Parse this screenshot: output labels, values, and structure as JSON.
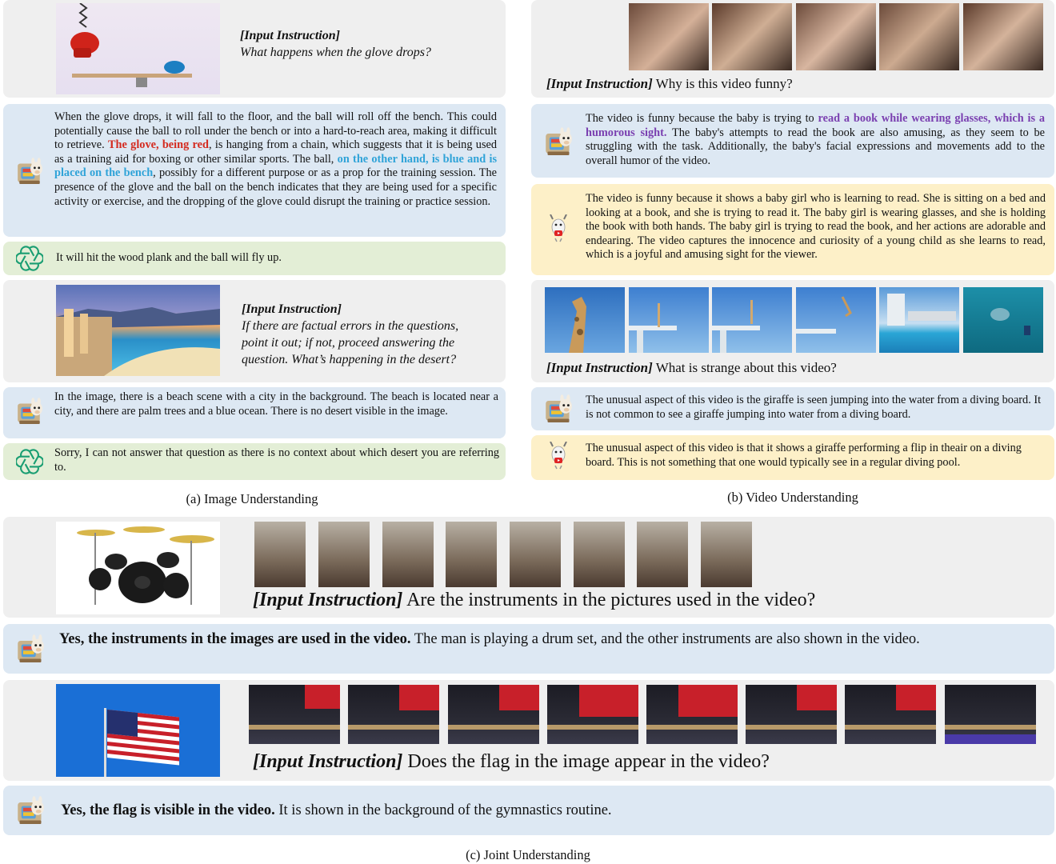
{
  "panel_a": {
    "q1": {
      "instruction_label": "[Input Instruction]",
      "instruction_text": "What happens when the glove drops?",
      "answer_ours_pre": "When the glove drops, it will fall to the floor, and the ball will roll off the bench. This could potentially cause the ball to roll under the bench or into a hard-to-reach area, making it difficult to retrieve. ",
      "answer_ours_hl1": "The glove, being red",
      "answer_ours_mid": ", is hanging from a chain, which suggests that it is being used as a training aid for boxing or other similar sports. The ball, ",
      "answer_ours_hl2": "on the other hand, is blue and is placed on the bench",
      "answer_ours_post": ", possibly for a different purpose or as a prop for the training session. The presence of the glove and the ball on the bench indicates that they are being used for a specific activity or exercise, and the dropping of the glove could disrupt the training or practice session.",
      "answer_gpt": "It will hit the wood plank and the ball will fly up."
    },
    "q2": {
      "instruction_label": "[Input Instruction]",
      "instruction_text": "If there are factual errors in the questions, point it out; if not, proceed answering the question. What’s happening in the desert?",
      "answer_ours": "In the image, there is a beach scene with a city in the background. The beach is located near a city, and there are palm trees and a blue ocean. There is no desert visible in the image.",
      "answer_gpt": "Sorry, I can not answer that question as there is no context about which desert you are referring to."
    },
    "caption": "(a) Image Understanding"
  },
  "panel_b": {
    "q1": {
      "instruction_label": "[Input Instruction]",
      "instruction_text": " Why is this video funny?",
      "answer_ours_pre": "The video is funny because the baby is trying to ",
      "answer_ours_hl": "read a book while wearing glasses, which is a humorous sight.",
      "answer_ours_post": " The baby's attempts to read the book are also amusing, as they seem to be struggling with the task. Additionally, the baby's facial expressions and movements add to the overall humor of the video.",
      "answer_other": "The video is funny because it shows a baby girl who is learning to read. She is sitting on a bed and looking at a book, and she is trying to read it. The baby girl is wearing glasses, and she is holding the book with both hands. The baby girl is trying to read the book, and her actions are adorable and endearing. The video captures the innocence and curiosity of a young child as she learns to read, which is a joyful and amusing sight for the viewer."
    },
    "q2": {
      "instruction_label": "[Input Instruction]",
      "instruction_text": " What is strange about this video?",
      "answer_ours": "The unusual aspect of this video is the giraffe is seen jumping into the water from a diving board. It is not common to see a giraffe jumping into water from a diving board.",
      "answer_other": "The unusual aspect of this video is that it shows a giraffe performing a flip in theair on a diving board. This is not something that one would typically see in a regular diving pool."
    },
    "caption": "(b) Video Understanding"
  },
  "panel_c": {
    "q1": {
      "instruction_label": "[Input Instruction]",
      "instruction_text": " Are the instruments in the pictures used in the video?",
      "answer_bold": "Yes, the instruments in the images are used in the video.",
      "answer_rest": " The man is playing a drum set, and the other instruments are also shown in the video."
    },
    "q2": {
      "instruction_label": "[Input Instruction]",
      "instruction_text": " Does the flag in the image appear in the video?",
      "answer_bold": "Yes, the flag is visible in the video.",
      "answer_rest": " It is shown in the background of the gymnastics routine."
    },
    "caption": "(c) Joint Understanding"
  },
  "colors": {
    "gray_box": "#efefef",
    "blue_box": "#dde8f3",
    "green_box": "#e3eed6",
    "yellow_box": "#fdf0c8",
    "highlight_red": "#d42a1f",
    "highlight_blue": "#2fa3d8",
    "highlight_purple": "#7a3fb0"
  },
  "icons": {
    "model_avatar": "llama-avatar-icon",
    "chatgpt": "chatgpt-logo-icon",
    "video_model": "goat-avatar-icon"
  }
}
